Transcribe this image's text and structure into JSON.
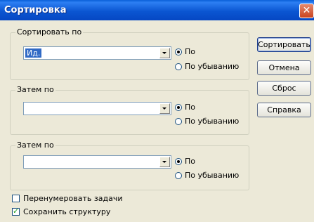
{
  "window": {
    "title": "Сортировка",
    "close_glyph": "✕"
  },
  "groups": [
    {
      "label": "Сортировать по",
      "value": "Ид.",
      "asc_label": "По",
      "desc_label": "По убыванию",
      "selected": "asc"
    },
    {
      "label": "Затем по",
      "value": "",
      "asc_label": "По",
      "desc_label": "По убыванию",
      "selected": "asc"
    },
    {
      "label": "Затем по",
      "value": "",
      "asc_label": "По",
      "desc_label": "По убыванию",
      "selected": "asc"
    }
  ],
  "buttons": {
    "sort": "Сортировать",
    "cancel": "Отмена",
    "reset": "Сброс",
    "help": "Справка"
  },
  "options": {
    "renumber": {
      "label": "Перенумеровать задачи",
      "checked": false
    },
    "keep_structure": {
      "label": "Сохранить структуру",
      "checked": true
    }
  },
  "colors": {
    "title_bar": "#0b56d2",
    "dialog_bg": "#ece9d8",
    "selection": "#316ac5"
  },
  "icons": {
    "close": "close-icon",
    "dropdown": "chevron-down-icon"
  }
}
